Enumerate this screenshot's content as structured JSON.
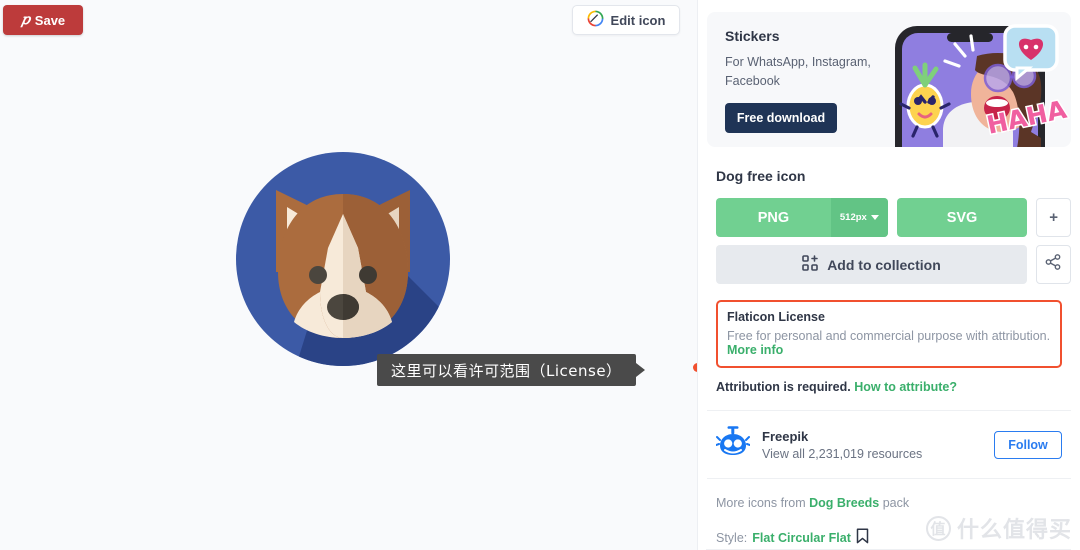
{
  "left": {
    "save_button": {
      "label": "Save",
      "icon": "pinterest-icon",
      "color": "#bd3b3b"
    },
    "edit_icon_button": {
      "label": "Edit icon",
      "icon": "brush-pen-icon"
    },
    "preview": {
      "name": "dog-free-icon-preview",
      "circle_color": "#3c5aa6",
      "shadow_color": "#2a4386",
      "fur_color": "#ab6c3e",
      "fur_dark_color": "#9c6037",
      "face_color": "#f7ead9",
      "face_shade_color": "#e7d5c0",
      "eye_color": "#4b463e"
    },
    "callout": {
      "text": "这里可以看许可范围（License）",
      "background": "#4a4a4a",
      "marker_color": "#f1502f"
    }
  },
  "ad": {
    "title": "Stickers",
    "subtitle": "For WhatsApp, Instagram, Facebook",
    "cta_label": "Free download",
    "cta_color": "#1f3456",
    "image_alt": "phone-with-stickers-image",
    "sticker_text": "HAHA"
  },
  "icon_detail": {
    "title": "Dog free icon",
    "png_label": "PNG",
    "png_size": "512px",
    "svg_label": "SVG",
    "more_formats_label": "+",
    "add_to_collection_label": "Add to collection",
    "share_label": "share-icon",
    "green": "#71d091"
  },
  "license": {
    "title": "Flaticon License",
    "description": "Free for personal and commercial purpose with attribution.",
    "more_info_label": "More info",
    "highlight_color": "#f1502f",
    "attribution_text": "Attribution is required.",
    "attribution_link": "How to attribute?"
  },
  "author": {
    "name": "Freepik",
    "resources": "View all 2,231,019 resources",
    "follow_label": "Follow",
    "avatar": "freepik-robot-avatar",
    "accent": "#2a7cf0"
  },
  "footer": {
    "pack_prefix": "More icons from",
    "pack_name": "Dog Breeds",
    "pack_suffix": "pack",
    "style_prefix": "Style:",
    "style_name": "Flat Circular Flat",
    "bookmark_icon": "bookmark-icon"
  },
  "watermark": {
    "mark": "值",
    "text": "什么值得买"
  }
}
